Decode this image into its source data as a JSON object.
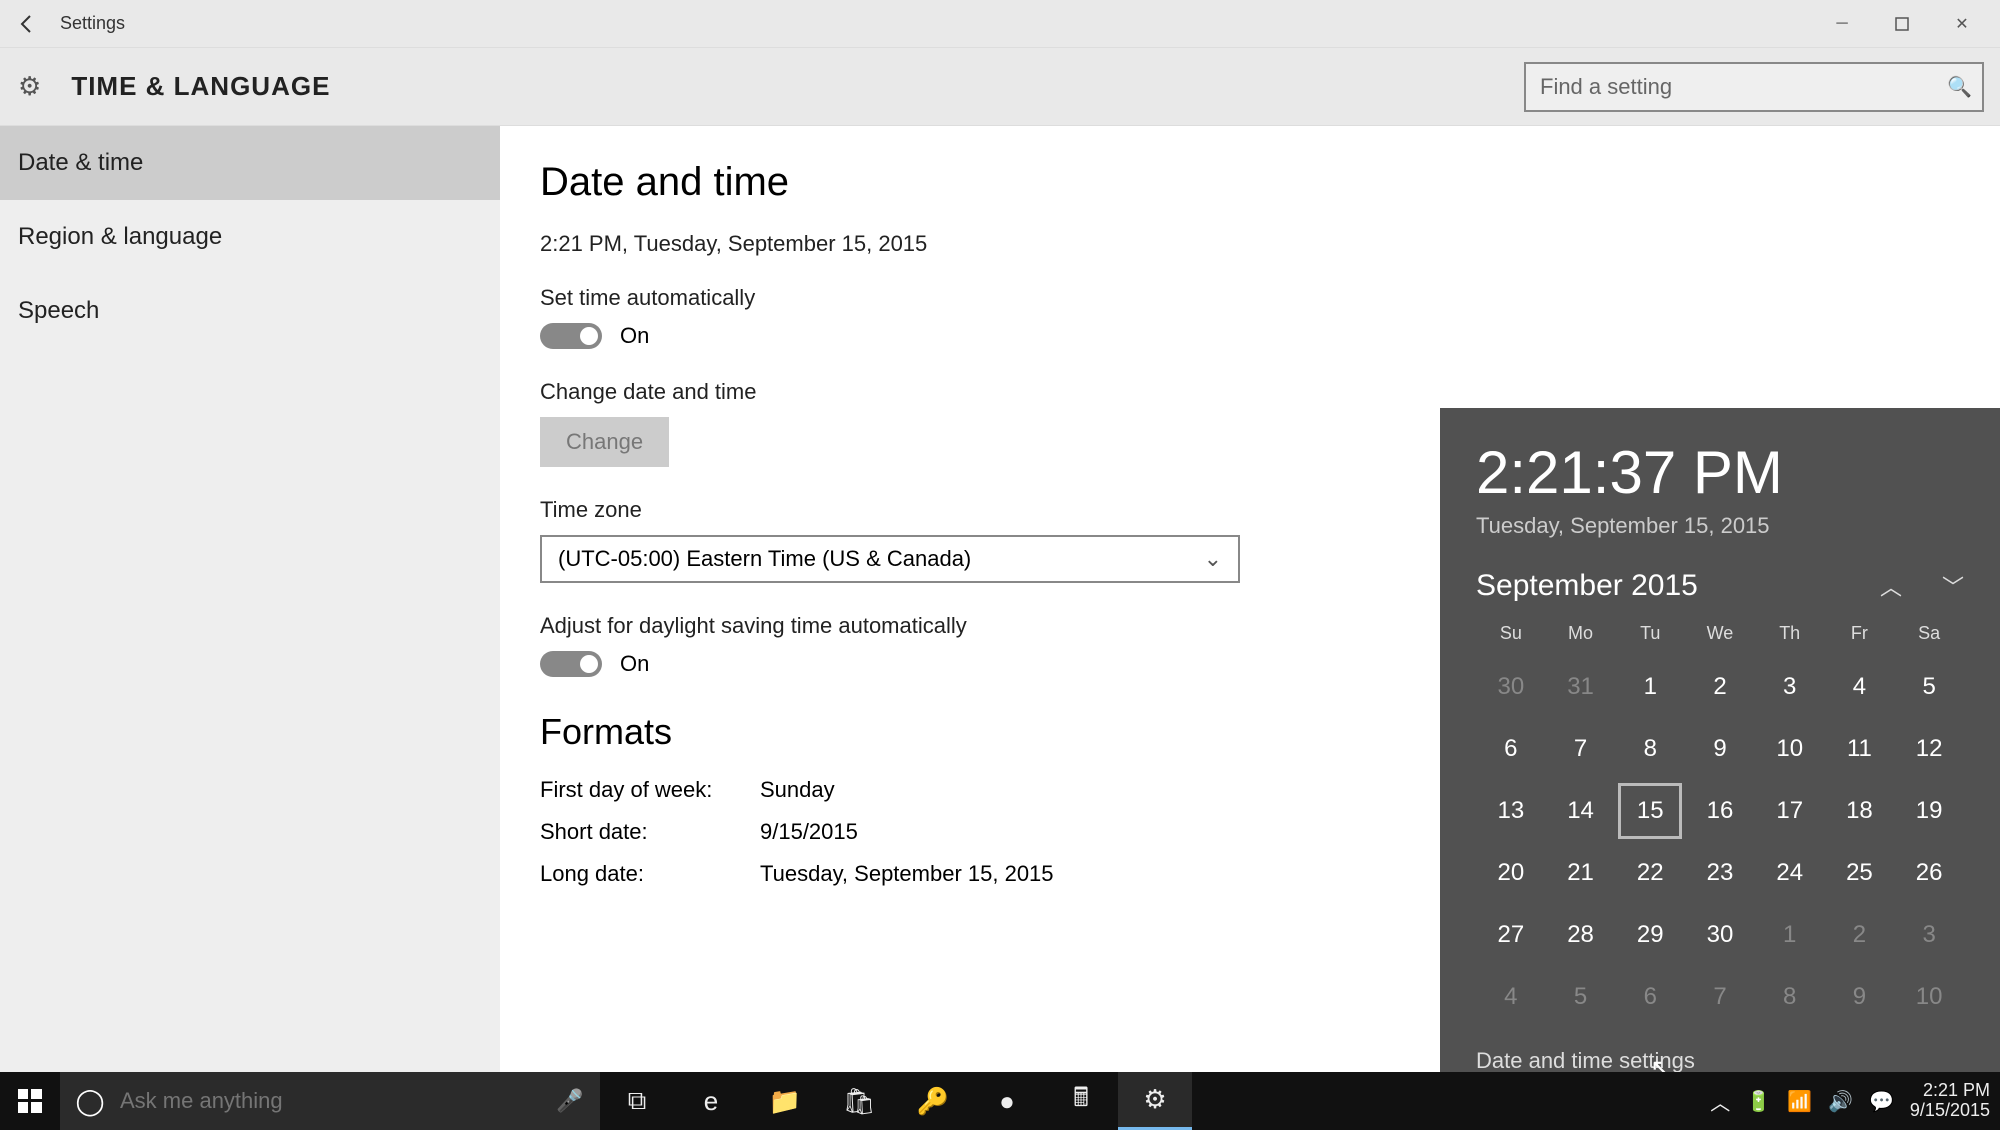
{
  "app_title": "Settings",
  "section_title": "TIME & LANGUAGE",
  "search": {
    "placeholder": "Find a setting"
  },
  "sidebar": {
    "items": [
      {
        "label": "Date & time",
        "active": true
      },
      {
        "label": "Region & language",
        "active": false
      },
      {
        "label": "Speech",
        "active": false
      }
    ]
  },
  "main": {
    "heading": "Date and time",
    "current": "2:21 PM, Tuesday, September 15, 2015",
    "set_auto_label": "Set time automatically",
    "set_auto_state": "On",
    "change_label": "Change date and time",
    "change_button": "Change",
    "timezone_label": "Time zone",
    "timezone_value": "(UTC-05:00) Eastern Time (US & Canada)",
    "dst_label": "Adjust for daylight saving time automatically",
    "dst_state": "On",
    "formats_heading": "Formats",
    "formats": {
      "first_day_label": "First day of week:",
      "first_day_value": "Sunday",
      "short_date_label": "Short date:",
      "short_date_value": "9/15/2015",
      "long_date_label": "Long date:",
      "long_date_value": "Tuesday, September 15, 2015"
    }
  },
  "flyout": {
    "time": "2:21:37 PM",
    "date": "Tuesday, September 15, 2015",
    "month": "September 2015",
    "dow": [
      "Su",
      "Mo",
      "Tu",
      "We",
      "Th",
      "Fr",
      "Sa"
    ],
    "weeks": [
      [
        {
          "d": "30",
          "dim": true
        },
        {
          "d": "31",
          "dim": true
        },
        {
          "d": "1"
        },
        {
          "d": "2"
        },
        {
          "d": "3"
        },
        {
          "d": "4"
        },
        {
          "d": "5"
        }
      ],
      [
        {
          "d": "6"
        },
        {
          "d": "7"
        },
        {
          "d": "8"
        },
        {
          "d": "9"
        },
        {
          "d": "10"
        },
        {
          "d": "11"
        },
        {
          "d": "12"
        }
      ],
      [
        {
          "d": "13"
        },
        {
          "d": "14"
        },
        {
          "d": "15",
          "today": true
        },
        {
          "d": "16"
        },
        {
          "d": "17"
        },
        {
          "d": "18"
        },
        {
          "d": "19"
        }
      ],
      [
        {
          "d": "20"
        },
        {
          "d": "21"
        },
        {
          "d": "22"
        },
        {
          "d": "23"
        },
        {
          "d": "24"
        },
        {
          "d": "25"
        },
        {
          "d": "26"
        }
      ],
      [
        {
          "d": "27"
        },
        {
          "d": "28"
        },
        {
          "d": "29"
        },
        {
          "d": "30"
        },
        {
          "d": "1",
          "dim": true
        },
        {
          "d": "2",
          "dim": true
        },
        {
          "d": "3",
          "dim": true
        }
      ],
      [
        {
          "d": "4",
          "dim": true
        },
        {
          "d": "5",
          "dim": true
        },
        {
          "d": "6",
          "dim": true
        },
        {
          "d": "7",
          "dim": true
        },
        {
          "d": "8",
          "dim": true
        },
        {
          "d": "9",
          "dim": true
        },
        {
          "d": "10",
          "dim": true
        }
      ]
    ],
    "link": "Date and time settings"
  },
  "taskbar": {
    "cortana_placeholder": "Ask me anything",
    "tray_time": "2:21 PM",
    "tray_date": "9/15/2015"
  }
}
